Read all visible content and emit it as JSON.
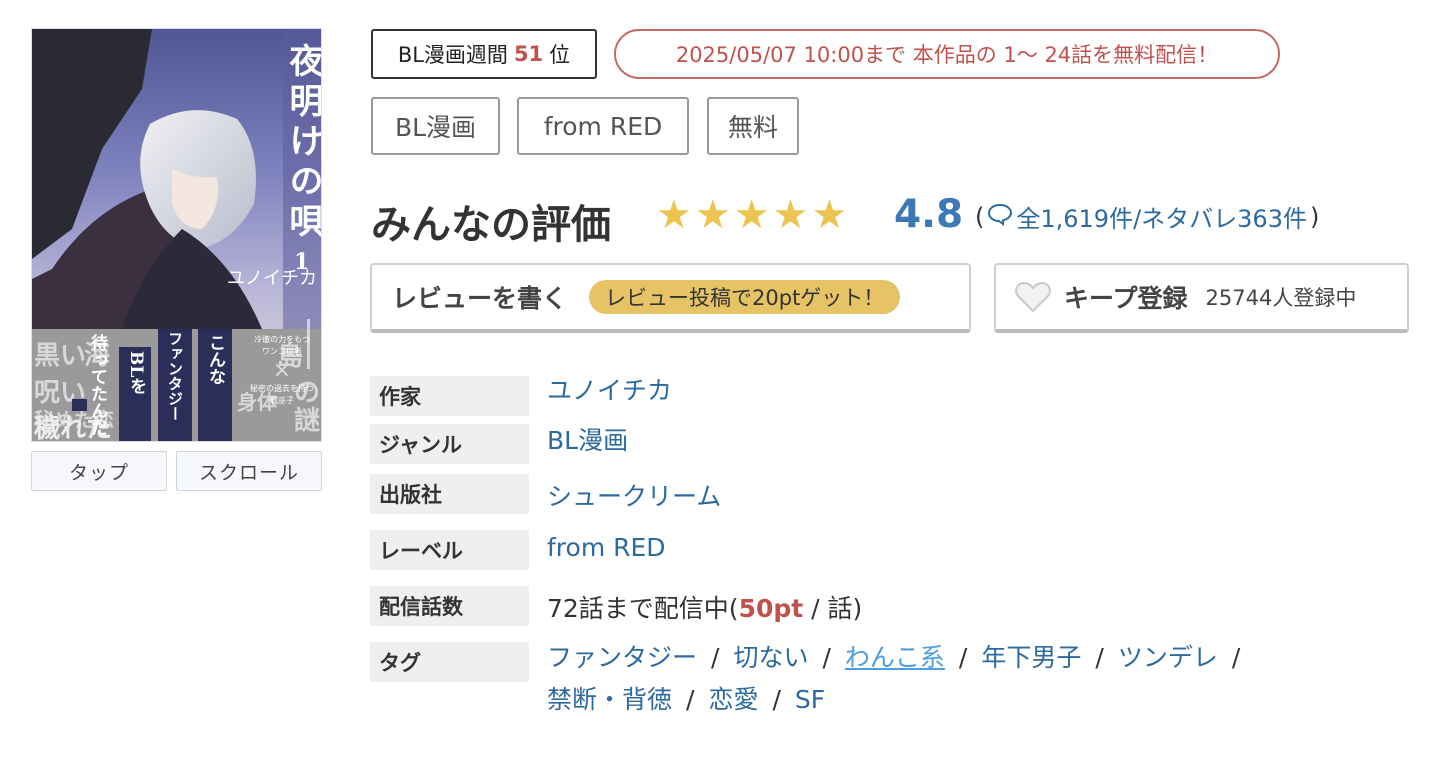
{
  "cover": {
    "vertical_title": "夜明けの唄",
    "volume": "1",
    "author_on_cover": "ユノイチカ",
    "banner_text": [
      "こんな",
      "ファンタジー",
      "BLを",
      "待ってたんだ"
    ],
    "right_blurb": [
      "冷徹の力をもつ",
      "ワンコ従者",
      "×",
      "秘密の過去を持つ",
      "戦巫子"
    ],
    "bg_words": [
      "黒い",
      "海",
      "呪い",
      "秘めた恋",
      "穢れた",
      "島",
      "の",
      "謎",
      "身体"
    ],
    "tap_label": "タップ",
    "scroll_label": "スクロール"
  },
  "badges": {
    "rank_prefix": "BL漫画週間",
    "rank_number": "51",
    "rank_suffix": "位",
    "free_text": "2025/05/07 10:00まで 本作品の 1〜 24話を無料配信！"
  },
  "categories": [
    "BL漫画",
    "from RED",
    "無料"
  ],
  "rating": {
    "title": "みんなの評価",
    "score": "4.8",
    "stars": 5,
    "open_paren": "(",
    "reviews": "全1,619件/ネタバレ363件",
    "close_paren": ")"
  },
  "actions": {
    "review_label": "レビューを書く",
    "review_bonus": "レビュー投稿で20ptゲット！",
    "keep_label": "キープ登録",
    "keep_count": "25744人登録中"
  },
  "info": {
    "author_label": "作家",
    "author": "ユノイチカ",
    "genre_label": "ジャンル",
    "genre": "BL漫画",
    "publisher_label": "出版社",
    "publisher": "シュークリーム",
    "label_label": "レーベル",
    "label": "from RED",
    "episodes_label": "配信話数",
    "episodes_pre": "72話まで配信中(",
    "episodes_pt": "50pt",
    "episodes_mid": " / ",
    "episodes_post": "話)",
    "tags_label": "タグ",
    "tags_row1": [
      "ファンタジー",
      "切ない",
      "わんこ系",
      "年下男子",
      "ツンデレ"
    ],
    "tags_row2": [
      "禁断・背徳",
      "恋愛",
      "SF"
    ],
    "separator": "/"
  },
  "colors": {
    "accent_red": "#c0524e",
    "link_blue": "#2d6a9f",
    "star_gold": "#ecc450",
    "pill_gold": "#e6c465"
  }
}
